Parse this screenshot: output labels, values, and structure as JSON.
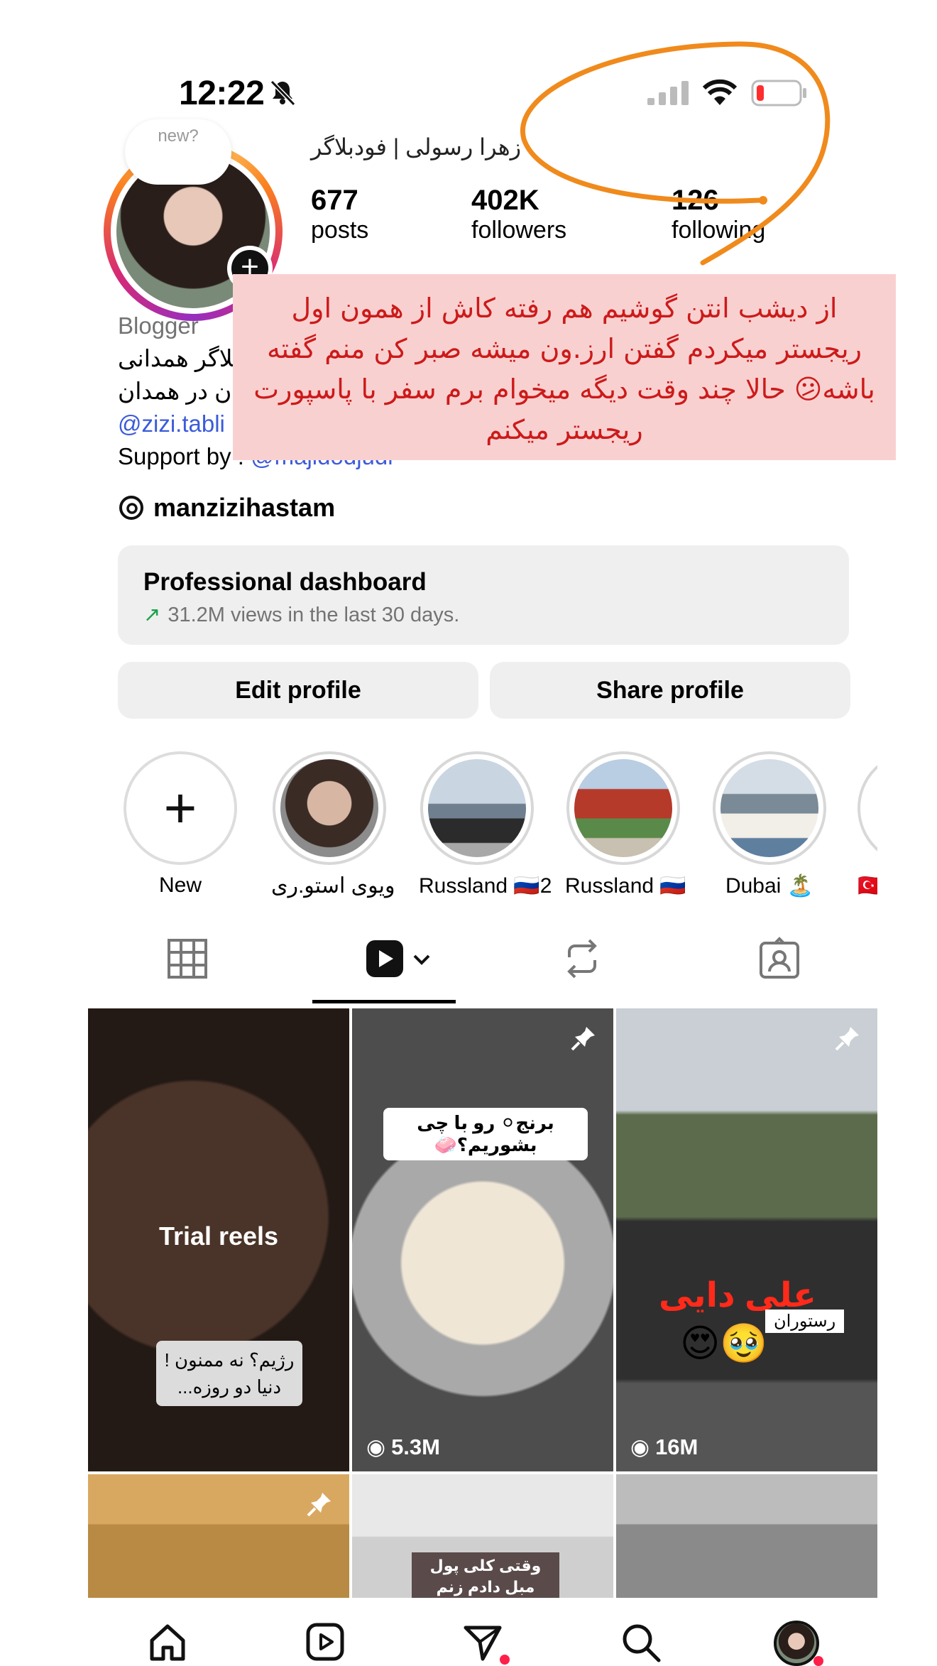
{
  "status_bar": {
    "time": "12:22"
  },
  "profile": {
    "note": "new?",
    "name_strip": "زهرا رسولی | فودبلاگر",
    "stats": [
      {
        "value": "677",
        "label": "posts"
      },
      {
        "value": "402K",
        "label": "followers"
      },
      {
        "value": "126",
        "label": "following"
      }
    ],
    "bio": {
      "category": "Blogger",
      "line1": "بلاگر همدانی",
      "line2": "ن در همدان",
      "link": "@zizi.tabli",
      "support_prefix": "Support by :",
      "support_handle": "@majidodjudi"
    },
    "threads_handle": "manzizihastam"
  },
  "overlay_text": "از دیشب انتن گوشیم هم رفته کاش از همون اول ریجستر میکردم گفتن ارز.ون میشه صبر کن منم گفته باشه😕 حالا چند وقت دیگه میخوام برم سفر با پاسپورت ریجستر میکنم",
  "dashboard": {
    "title": "Professional dashboard",
    "subtitle": "31.2M views in the last 30 days."
  },
  "buttons": {
    "edit": "Edit profile",
    "share": "Share profile"
  },
  "highlights": [
    {
      "label": "New"
    },
    {
      "label": "ویوی استو.ری"
    },
    {
      "label": "Russland 🇷🇺2"
    },
    {
      "label": "Russland 🇷🇺"
    },
    {
      "label": "Dubai 🏝️"
    },
    {
      "label": "🇹🇷"
    }
  ],
  "grid": {
    "cells": [
      {
        "overlay": "Trial reels",
        "caption": "رژیم؟ نه ممنون !\nدنیا دو روزه..."
      },
      {
        "caption": "برنج⚪ رو با چی بشوریم؟🧼",
        "views": "5.3M"
      },
      {
        "caption_name": "علی دایی",
        "caption_sub": "رستوران",
        "emoji": "😍🥹",
        "views": "16M"
      },
      {},
      {
        "caption": "وقتی کلی پول مبل دادم زنم نمیزاره روش بشینم"
      },
      {}
    ]
  },
  "colors": {
    "accent_orange": "#f08a1c",
    "overlay_bg": "#f9d0d0",
    "overlay_text": "#cc1a1a",
    "link": "#3b5bdb",
    "notification": "#ff1f4b"
  }
}
